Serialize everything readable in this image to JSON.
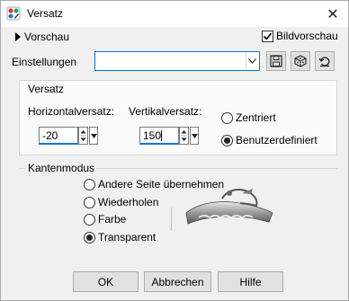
{
  "window": {
    "title": "Versatz"
  },
  "header": {
    "preview_toggle": "Vorschau",
    "image_preview": {
      "label": "Bildvorschau",
      "checked": true
    }
  },
  "settings": {
    "label": "Einstellungen",
    "value": ""
  },
  "offset": {
    "group_label": "Versatz",
    "horizontal": {
      "label": "Horizontalversatz:",
      "value": "-20"
    },
    "vertical": {
      "label": "Vertikalversatz:",
      "value": "150"
    },
    "options": [
      {
        "label": "Zentriert",
        "checked": false
      },
      {
        "label": "Benutzerdefiniert",
        "checked": true
      }
    ]
  },
  "edge_mode": {
    "group_label": "Kantenmodus",
    "options": [
      {
        "label": "Andere Seite übernehmen",
        "checked": false
      },
      {
        "label": "Wiederholen",
        "checked": false
      },
      {
        "label": "Farbe",
        "checked": false
      },
      {
        "label": "Transparent",
        "checked": true
      }
    ]
  },
  "buttons": {
    "ok": "OK",
    "cancel": "Abbrechen",
    "help": "Hilfe"
  },
  "icons": {
    "app": "app-icon",
    "close": "close-icon",
    "save": "save-preset-icon",
    "random": "dice-icon",
    "reset": "reset-icon"
  },
  "colors": {
    "accent": "#0078d7",
    "dialog_bg": "#f0f0f0"
  }
}
